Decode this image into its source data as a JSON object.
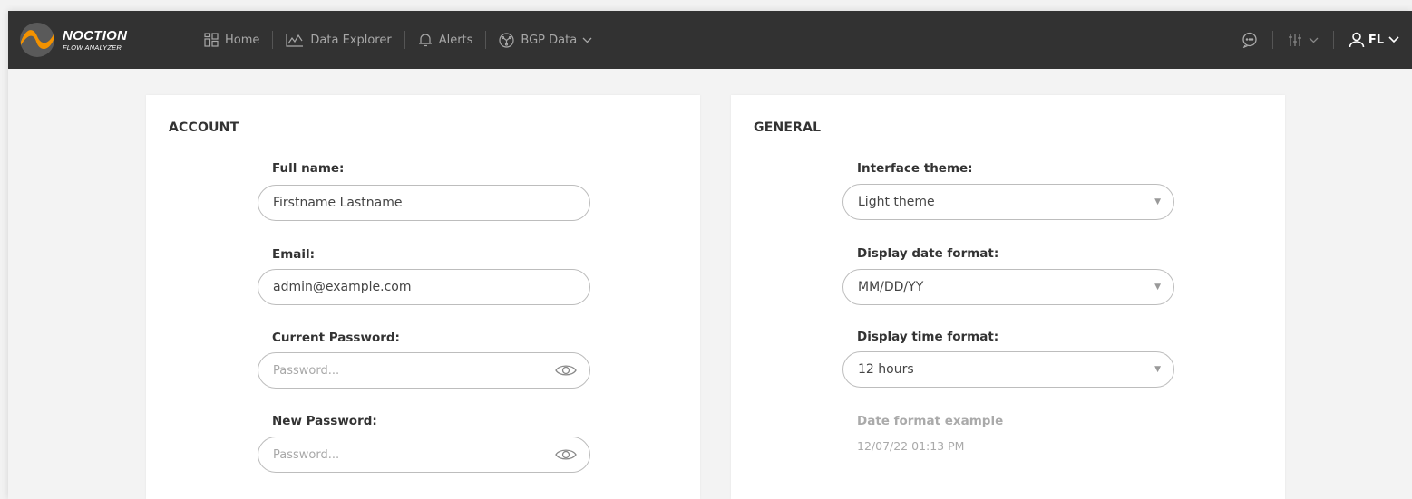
{
  "brand": {
    "name": "NOCTION",
    "subtitle": "FLOW ANALYZER"
  },
  "nav": {
    "home": "Home",
    "data_explorer": "Data Explorer",
    "alerts": "Alerts",
    "bgp_data": "BGP Data"
  },
  "user": {
    "initials": "FL"
  },
  "account": {
    "title": "ACCOUNT",
    "full_name_label": "Full name:",
    "full_name_value": "Firstname Lastname",
    "email_label": "Email:",
    "email_value": "admin@example.com",
    "current_password_label": "Current Password:",
    "current_password_placeholder": "Password...",
    "new_password_label": "New Password:",
    "new_password_placeholder": "Password..."
  },
  "general": {
    "title": "GENERAL",
    "theme_label": "Interface theme:",
    "theme_value": "Light theme",
    "date_format_label": "Display date format:",
    "date_format_value": "MM/DD/YY",
    "time_format_label": "Display time format:",
    "time_format_value": "12 hours",
    "example_label": "Date format example",
    "example_value": "12/07/22 01:13 PM"
  },
  "colors": {
    "topbar": "#323232",
    "accent": "#f39200"
  }
}
